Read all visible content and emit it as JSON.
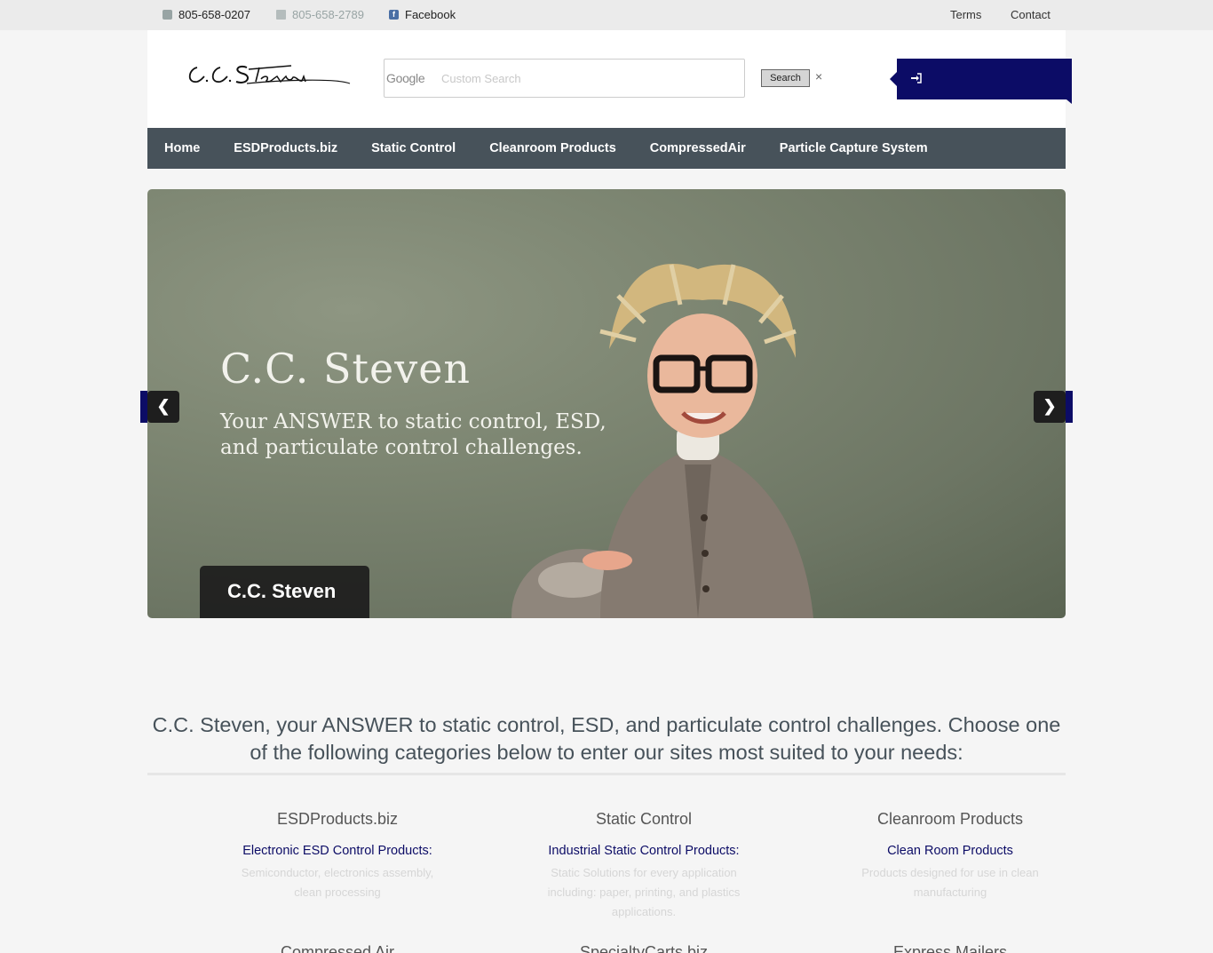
{
  "topbar": {
    "phone": "805-658-0207",
    "fax": "805-658-2789",
    "facebook": "Facebook",
    "terms": "Terms",
    "contact": "Contact"
  },
  "header": {
    "logo_text": "C.C.Steven",
    "search_brand": "Google",
    "search_placeholder": "Custom Search",
    "search_button": "Search",
    "clear": "×"
  },
  "nav": {
    "items": [
      {
        "label": "Home"
      },
      {
        "label": "ESDProducts.biz"
      },
      {
        "label": "Static Control"
      },
      {
        "label": "Cleanroom Products"
      },
      {
        "label": "CompressedAir"
      },
      {
        "label": "Particle Capture System"
      }
    ]
  },
  "slider": {
    "image_title": "C.C. Steven",
    "image_subtitle": "Your ANSWER to static control, ESD, and particulate control challenges.",
    "caption": "C.C. Steven",
    "prev_icon": "chevron-left-icon",
    "next_icon": "chevron-right-icon"
  },
  "intro": {
    "text": "C.C. Steven, your ANSWER to static control, ESD, and particulate control challenges. Choose one of the following categories below to enter our sites most suited to your needs:"
  },
  "categories": [
    {
      "title": "ESDProducts.biz",
      "link": "Electronic ESD Control Products:",
      "desc": "Semiconductor, electronics assembly, clean processing"
    },
    {
      "title": "Static Control",
      "link": "Industrial Static Control Products:",
      "desc": "Static Solutions for every application including: paper, printing, and plastics applications."
    },
    {
      "title": "Cleanroom Products",
      "link": "Clean Room Products",
      "desc": "Products designed for use in clean manufacturing"
    }
  ],
  "categories_row2": [
    {
      "title": "Compressed Air"
    },
    {
      "title": "SpecialtyCarts.biz"
    },
    {
      "title": "Express Mailers"
    }
  ],
  "colors": {
    "accent": "#0c0c66",
    "nav_bg": "#47525a",
    "topbar_bg": "#ebebeb"
  }
}
